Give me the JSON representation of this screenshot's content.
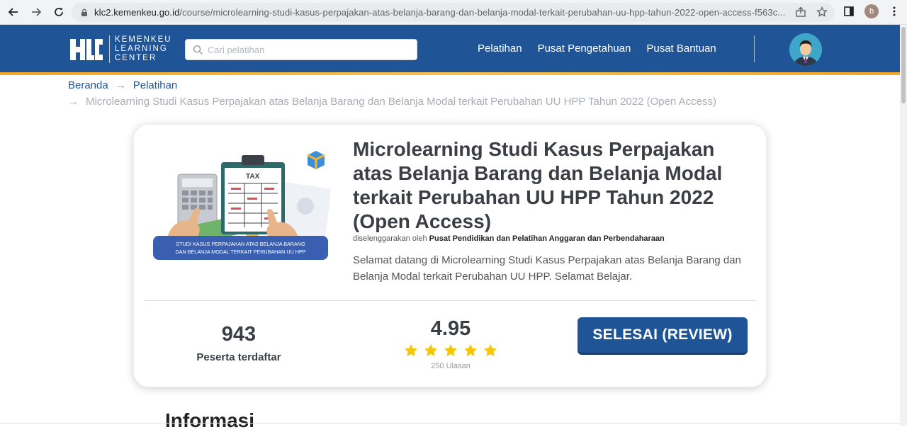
{
  "browser": {
    "url_host": "klc2.kemenkeu.go.id",
    "url_path": "/course/microlearning-studi-kasus-perpajakan-atas-belanja-barang-dan-belanja-modal-terkait-perubahan-uu-hpp-tahun-2022-open-access-f563c...",
    "profile_initial": "b"
  },
  "header": {
    "logo_line1": "KEMENKEU",
    "logo_line2": "LEARNING",
    "logo_line3": "CENTER",
    "search_placeholder": "Cari pelatihan",
    "nav": [
      "Pelatihan",
      "Pusat Pengetahuan",
      "Pusat Bantuan"
    ]
  },
  "breadcrumb": {
    "home": "Beranda",
    "section": "Pelatihan",
    "current": "Microlearning Studi Kasus Perpajakan atas Belanja Barang dan Belanja Modal terkait Perubahan UU HPP Tahun 2022 (Open Access)",
    "separator": "→"
  },
  "course": {
    "title": "Microlearning Studi Kasus Perpajakan atas Belanja Barang dan Belanja Modal terkait Perubahan UU HPP Tahun 2022 (Open Access)",
    "organizer_prefix": "diselenggarakan oleh",
    "organizer": "Pusat Pendidikan dan Pelatihan Anggaran dan Perbendaharaan",
    "description": "Selamat datang di Microlearning Studi Kasus Perpajakan atas Belanja Barang dan Belanja Modal terkait Perubahan UU HPP. Selamat Belajar.",
    "thumbnail": {
      "tax_label": "TAX",
      "caption_line1": "STUDI KASUS PERPAJAKAN ATAS BELANJA BARANG",
      "caption_line2": "DAN BELANJA MODAL TERKAIT PERUBAHAN UU HPP"
    },
    "enrolled_count": "943",
    "enrolled_label": "Peserta terdaftar",
    "rating": "4.95",
    "rating_stars": 5,
    "reviews": "250 Ulasan",
    "cta_label": "SELESAI (REVIEW)"
  },
  "section_heading": "Informasi",
  "colors": {
    "brand_blue": "#1f5597",
    "accent_orange": "#f5a623",
    "star_yellow": "#f7c600"
  }
}
